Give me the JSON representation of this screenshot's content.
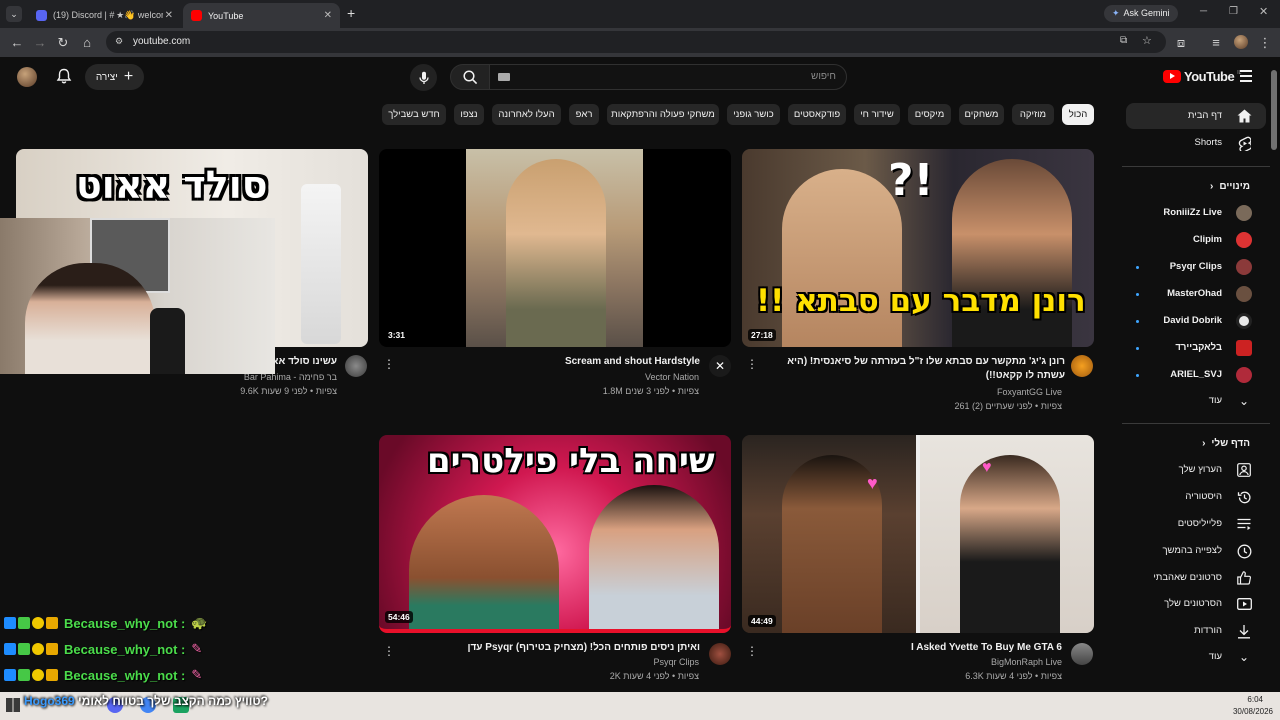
{
  "browser": {
    "tabs": [
      {
        "label": "(19) Discord | # ★👋 welcome",
        "active": false
      },
      {
        "label": "YouTube",
        "active": true
      }
    ],
    "new_tab": "+",
    "url": "youtube.com",
    "ask_gemini": "Ask Gemini"
  },
  "header": {
    "search_placeholder": "חיפוש",
    "create_label": "יצירה",
    "logo_text": "YouTube",
    "logo_region": "IL"
  },
  "chips": [
    "הכול",
    "מוזיקה",
    "משחקים",
    "מיקסים",
    "שידור חי",
    "פודקאסטים",
    "כושר גופני",
    "משחקי פעולה והרפתקאות",
    "ראפ",
    "העלו לאחרונה",
    "נצפו",
    "חדש בשבילך"
  ],
  "sidebar": {
    "home": "דף הבית",
    "shorts": "Shorts",
    "subscriptions_title": "מינויים",
    "subscriptions": [
      {
        "name": "RoniiiZz Live",
        "live": false,
        "color": "#7a6a5a"
      },
      {
        "name": "Clipim",
        "live": false,
        "color": "#d33"
      },
      {
        "name": "Psyqr Clips",
        "live": true,
        "color": "#8b3a3a"
      },
      {
        "name": "MasterOhad",
        "live": true,
        "color": "#6a5040"
      },
      {
        "name": "David Dobrik",
        "live": true,
        "color": "#e8e8e8"
      },
      {
        "name": "בלאקביירד",
        "live": true,
        "color": "#c22"
      },
      {
        "name": "ARIEL_SVJ",
        "live": true,
        "color": "#b02a3a"
      }
    ],
    "more": "עוד",
    "you_title": "הדף שלי",
    "you_items": [
      "הערוץ שלך",
      "היסטוריה",
      "פלייליסטים",
      "לצפייה בהמשך",
      "סרטונים שאהבתי",
      "הסרטונים שלך",
      "הורדות"
    ],
    "you_more": "עוד"
  },
  "videos": [
    {
      "title": "רונן ג'יג' מתקשר עם סבתא שלו ז\"ל בעזרתה של סיאנסית! (היא עשתה לו קקאט!!)",
      "channel": "FoxyantGG Live",
      "meta": "261 צפיות • לפני שעתיים (2)",
      "duration": "27:18",
      "thumb_text": "!! רונן מדבר עם סבתא"
    },
    {
      "title": "Scream and shout  Hardstyle",
      "channel": "Vector Nation",
      "meta": "1.8M צפיות • לפני 3 שנים",
      "duration": "3:31"
    },
    {
      "title": "עשינו סולד אאוט",
      "channel": "Bar Pahima - בר פחימה",
      "meta": "9.6K צפיות • לפני 9 שעות",
      "thumb_text": "סולד אאוט"
    },
    {
      "title": "I Asked Yvette To Buy Me GTA 6",
      "channel": "BigMonRaph Live",
      "meta": "6.3K צפיות • לפני 4 שעות",
      "duration": "44:49"
    },
    {
      "title": "עדן Psyqr ואיתן ניסים פותחים הכל! (מצחיק בטירוף)",
      "channel": "Psyqr Clips",
      "meta": "2K צפיות • לפני 4 שעות",
      "duration": "54:46",
      "thumb_text": "שיחה בלי פילטרים"
    }
  ],
  "overlay_chat": {
    "lines": [
      "Because_why_not :",
      "Because_why_not :",
      "Because_why_not :"
    ],
    "bottom_name": "Hogo369",
    "bottom_msg": "טוויץ כמה הקצב שלך בטווח לאומי?"
  },
  "taskbar": {
    "time": "6:04",
    "date": "30/08/2026"
  },
  "colors": {
    "yt_red": "#ff0000",
    "background": "#0f0f0f",
    "chip_bg": "#272727"
  }
}
